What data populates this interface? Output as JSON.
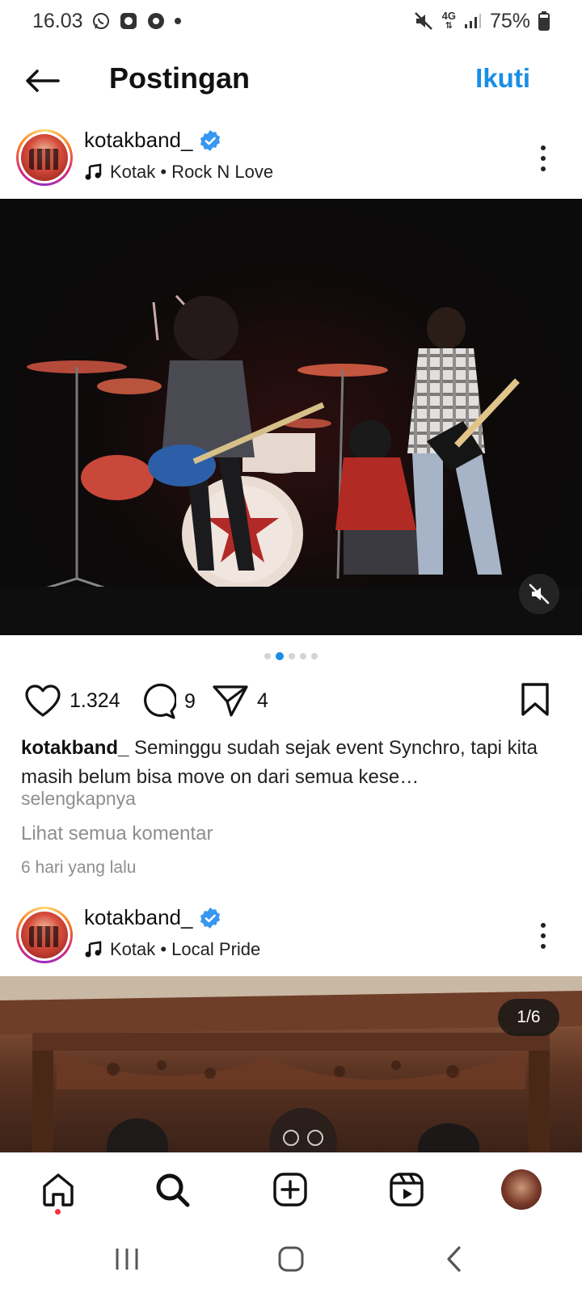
{
  "status_bar": {
    "time": "16.03",
    "network": "4G",
    "battery": "75%"
  },
  "header": {
    "title": "Postingan",
    "follow_label": "Ikuti"
  },
  "posts": [
    {
      "username": "kotakband_",
      "music": "Kotak • Rock N Love"
    },
    {
      "username": "kotakband_",
      "music": "Kotak • Local Pride",
      "pager": "1/6"
    }
  ],
  "carousel": {
    "active_index": 1,
    "count": 5
  },
  "actions": {
    "likes": "1.324",
    "comments": "9",
    "shares": "4"
  },
  "caption": {
    "username": "kotakband_",
    "text": "Seminggu sudah sejak event Synchro, tapi kita masih belum bisa move on dari semua kese…",
    "more_label": "selengkapnya"
  },
  "comments_link": "Lihat semua komentar",
  "timestamp": "6 hari yang lalu",
  "colors": {
    "accent": "#1a8ee6",
    "verified": "#3897f0",
    "notification": "#ff3040"
  }
}
